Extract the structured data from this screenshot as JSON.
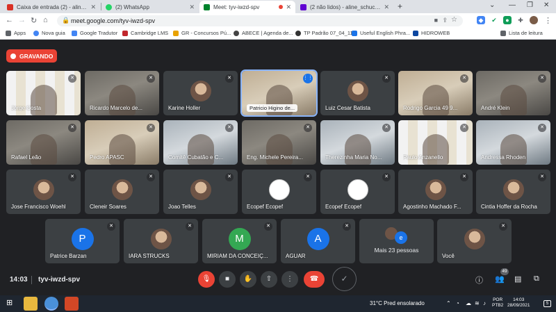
{
  "browser": {
    "tabs": [
      {
        "label": "Caixa de entrada (2) - aline_schuck",
        "favicon_color": "#d93025"
      },
      {
        "label": "(2) WhatsApp",
        "favicon_color": "#25d366"
      },
      {
        "label": "Meet: tyv-iwzd-spv",
        "favicon_color": "#00832d",
        "active": true
      },
      {
        "label": "(2 não lidos) - aline_schuck17@",
        "favicon_color": "#6001d2"
      }
    ],
    "new_tab": "+",
    "url": "meet.google.com/tyv-iwzd-spv",
    "bookmarks": [
      {
        "label": "Apps",
        "color": "#5f6368"
      },
      {
        "label": "Nova guia",
        "color": "#4285f4"
      },
      {
        "label": "Google Tradutor",
        "color": "#4285f4"
      },
      {
        "label": "Cambridge LMS",
        "color": "#c1272d"
      },
      {
        "label": "GR - Concursos Pú...",
        "color": "#e8a200"
      },
      {
        "label": "ABECE | Agenda de...",
        "color": "#444444"
      },
      {
        "label": "TP Padrão 07_04_11",
        "color": "#333333"
      },
      {
        "label": "Useful English Phra...",
        "color": "#1a73e8"
      },
      {
        "label": "HIDROWEB",
        "color": "#0d47a1"
      }
    ],
    "reading_list": "Lista de leitura"
  },
  "meet": {
    "recording_label": "GRAVANDO",
    "participants": [
      {
        "name": "Jorge Costa",
        "kind": "video",
        "style": "logo"
      },
      {
        "name": "Ricardo Marcelo de...",
        "kind": "video",
        "style": "plain"
      },
      {
        "name": "Karine Holler",
        "kind": "photo",
        "style": "tile"
      },
      {
        "name": "Patricio Higino de...",
        "kind": "video",
        "style": "warm",
        "speaking": true
      },
      {
        "name": "Luiz Cesar Batista",
        "kind": "photo",
        "style": "tile"
      },
      {
        "name": "Rodrigo Garcia 49 9...",
        "kind": "video",
        "style": "warm"
      },
      {
        "name": "André Klein",
        "kind": "video",
        "style": "plain"
      },
      {
        "name": "Rafael Leão",
        "kind": "video",
        "style": "plain"
      },
      {
        "name": "Pedro APASC",
        "kind": "video",
        "style": "warm"
      },
      {
        "name": "Comitê Cubatão e C...",
        "kind": "video",
        "style": "cool"
      },
      {
        "name": "Eng. Michele Pereira...",
        "kind": "video",
        "style": "plain"
      },
      {
        "name": "Therezinha Maria No...",
        "kind": "video",
        "style": "cool"
      },
      {
        "name": "Paulo Anzanello",
        "kind": "video",
        "style": "logo"
      },
      {
        "name": "Andressa Rhoden",
        "kind": "video",
        "style": "cool"
      },
      {
        "name": "Jose Francisco Woehl",
        "kind": "photo",
        "style": "tile"
      },
      {
        "name": "Cleneir Soares",
        "kind": "photo",
        "style": "tile"
      },
      {
        "name": "Joao Telles",
        "kind": "photo",
        "style": "tile"
      },
      {
        "name": "Ecopef Ecopef",
        "kind": "logo",
        "style": "tile"
      },
      {
        "name": "Ecopef Ecopef",
        "kind": "logo",
        "style": "tile"
      },
      {
        "name": "Agostinho Machado F...",
        "kind": "photo",
        "style": "tile"
      },
      {
        "name": "Cintia Hoffer da Rocha",
        "kind": "photo",
        "style": "tile"
      },
      {
        "name": "Patrice Barzan",
        "kind": "avatar",
        "initial": "P",
        "color": "#1a73e8"
      },
      {
        "name": "IARA STRUCKS",
        "kind": "photo",
        "style": "tile"
      },
      {
        "name": "MIRIAM DA CONCEIÇ...",
        "kind": "avatar",
        "initial": "M",
        "color": "#34a853"
      },
      {
        "name": "AGUAR",
        "kind": "avatar",
        "initial": "A",
        "color": "#1a73e8"
      },
      {
        "name": "Mais 23 pessoas",
        "kind": "more",
        "initial": "e"
      },
      {
        "name": "Você",
        "kind": "photo",
        "style": "tile"
      }
    ],
    "bottom": {
      "clock": "14:03",
      "meeting_code": "tyv-iwzd-spv",
      "people_count": "49"
    }
  },
  "taskbar": {
    "weather": "31°C  Pred ensolarado",
    "lang": "POR\nPTB2",
    "time": "14:03",
    "date": "28/09/2021",
    "notifications": "5"
  }
}
